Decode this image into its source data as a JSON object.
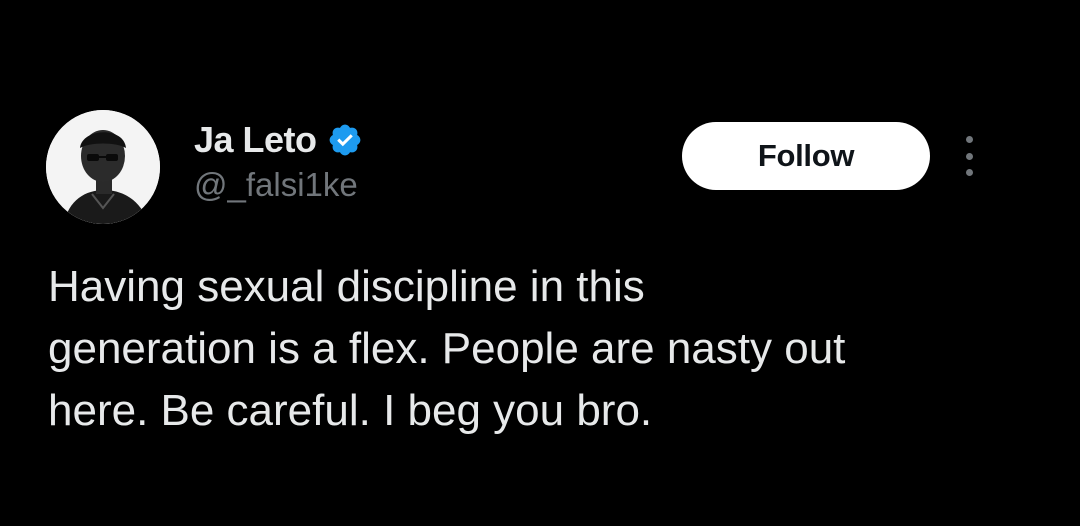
{
  "author": {
    "display_name": "Ja Leto",
    "handle": "@_falsi1ke",
    "verified_icon": "verified-badge-icon",
    "avatar_icon": "profile-photo"
  },
  "actions": {
    "follow_label": "Follow",
    "more_icon": "more-options-icon"
  },
  "tweet": {
    "lines": [
      "Having sexual discipline in this",
      "generation is a flex. People are nasty out",
      "here. Be careful. I beg you bro."
    ]
  },
  "colors": {
    "background": "#000000",
    "primary_text": "#e7e9ea",
    "secondary_text": "#71767b",
    "verified_blue": "#1d9bf0",
    "button_bg": "#ffffff",
    "button_text": "#0f1419"
  }
}
